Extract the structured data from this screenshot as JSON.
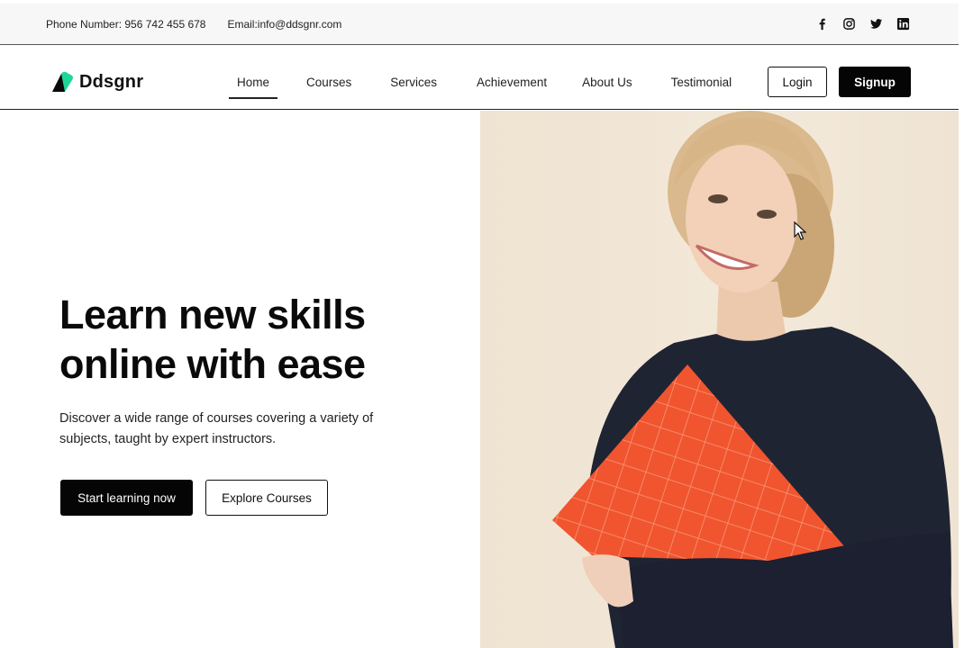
{
  "topbar": {
    "phone": "Phone Number: 956 742 455 678",
    "email": "Email:info@ddsgnr.com",
    "social": [
      "facebook-icon",
      "instagram-icon",
      "twitter-icon",
      "linkedin-icon"
    ]
  },
  "navbar": {
    "brand": "Ddsgnr",
    "links": [
      "Home",
      "Courses",
      "Services",
      "Achievement",
      "About Us",
      "Testimonial"
    ],
    "active": "Home",
    "login": "Login",
    "signup": "Signup"
  },
  "hero": {
    "title_line1": "Learn new skills",
    "title_line2": "online with ease",
    "description": "Discover a wide range of courses covering a variety of subjects, taught by expert instructors.",
    "primary_cta": "Start learning now",
    "secondary_cta": "Explore Courses"
  },
  "colors": {
    "brand_accent": "#1ed69a",
    "dark": "#050505",
    "photo_background": "#f0e5d4",
    "book": "#f0552f",
    "sweater": "#1f2433"
  }
}
